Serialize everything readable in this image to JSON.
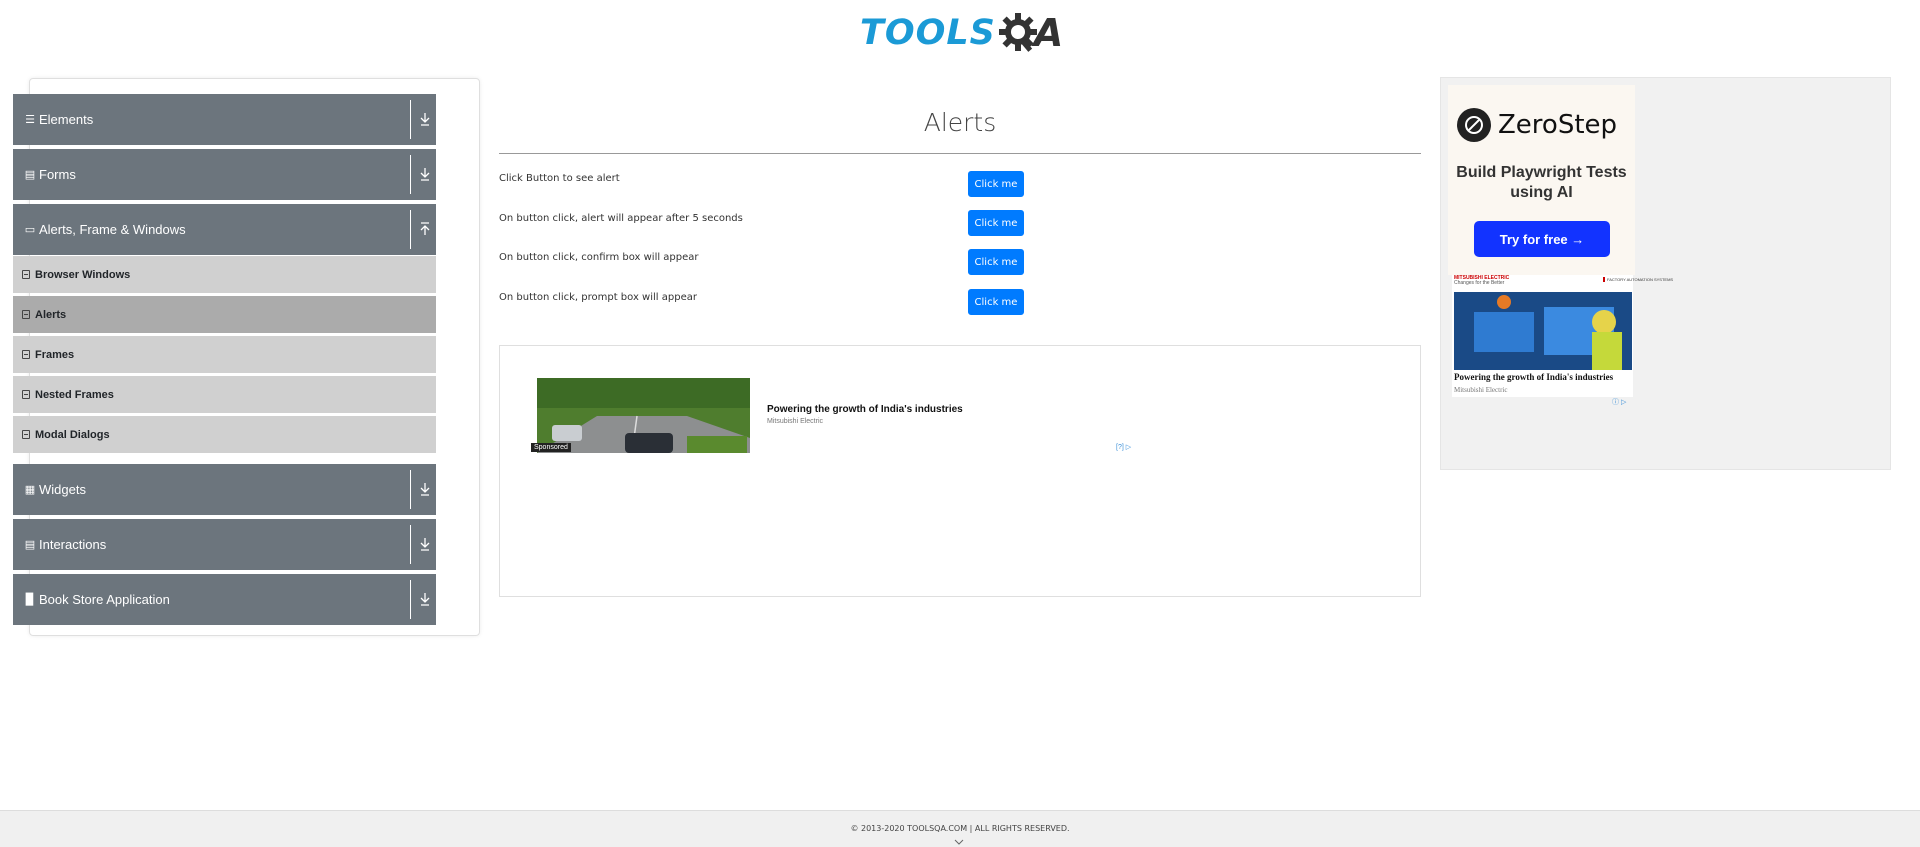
{
  "header": {
    "logo_text": "TOOLS",
    "logo_suffix": "A"
  },
  "sidebar": {
    "groups": [
      {
        "label": "Elements",
        "icon": "hamburger-icon"
      },
      {
        "label": "Forms",
        "icon": "form-icon"
      },
      {
        "label": "Alerts, Frame & Windows",
        "icon": "window-icon",
        "expanded": true,
        "items": [
          {
            "label": "Browser Windows"
          },
          {
            "label": "Alerts",
            "active": true
          },
          {
            "label": "Frames"
          },
          {
            "label": "Nested Frames"
          },
          {
            "label": "Modal Dialogs"
          }
        ]
      },
      {
        "label": "Widgets",
        "icon": "grid-icon"
      },
      {
        "label": "Interactions",
        "icon": "list-icon"
      },
      {
        "label": "Book Store Application",
        "icon": "bookshelf-icon"
      }
    ]
  },
  "main": {
    "title": "Alerts",
    "rows": [
      {
        "label": "Click Button to see alert",
        "button": "Click me"
      },
      {
        "label": "On button click, alert will appear after 5 seconds",
        "button": "Click me"
      },
      {
        "label": "On button click, confirm box will appear",
        "button": "Click me"
      },
      {
        "label": "On button click, prompt box will appear",
        "button": "Click me"
      }
    ],
    "accent_color": "#007bff"
  },
  "ad": {
    "sponsored": "Sponsored",
    "headline": "Powering the growth of India's industries",
    "advertiser": "Mitsubishi Electric",
    "choice": "[?]"
  },
  "right_ad": {
    "brand": "ZeroStep",
    "tagline": "Build Playwright Tests using AI",
    "cta": "Try for free →",
    "me_headline": "Powering the growth of India's industries",
    "me_advertiser": "Mitsubishi Electric",
    "me_logo": "MITSUBISHI ELECTRIC",
    "me_logo_sub": "Changes for the Better",
    "me_badge": "FACTORY AUTOMATION SYSTEMS"
  },
  "footer": {
    "text": "© 2013-2020 TOOLSQA.COM | ALL RIGHTS RESERVED."
  }
}
